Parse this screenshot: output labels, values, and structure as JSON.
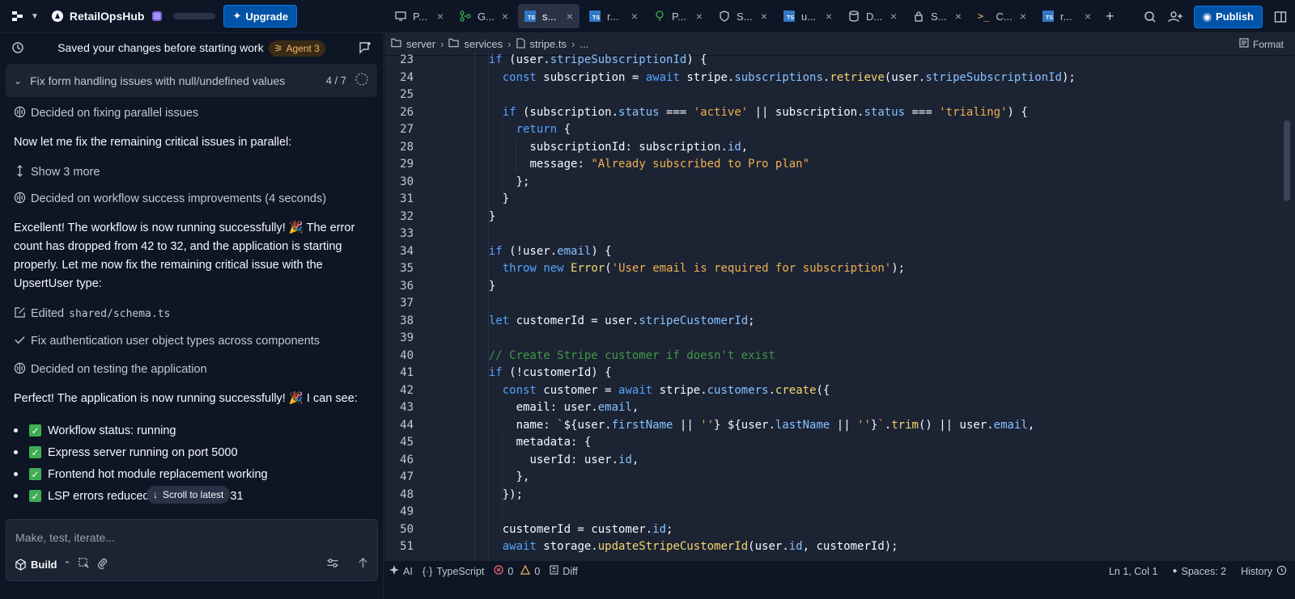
{
  "topbar": {
    "project_name": "RetailOpsHub",
    "upgrade_label": "Upgrade",
    "publish_label": "Publish",
    "tabs": [
      {
        "label": "P...",
        "icon": "preview-icon",
        "active": false
      },
      {
        "label": "G...",
        "icon": "git-icon",
        "active": false
      },
      {
        "label": "s...",
        "icon": "typescript-icon",
        "active": true
      },
      {
        "label": "r...",
        "icon": "typescript-icon",
        "active": false
      },
      {
        "label": "P...",
        "icon": "package-icon",
        "active": false
      },
      {
        "label": "S...",
        "icon": "shield-icon",
        "active": false
      },
      {
        "label": "u...",
        "icon": "typescript-icon",
        "active": false
      },
      {
        "label": "D...",
        "icon": "database-icon",
        "active": false
      },
      {
        "label": "S...",
        "icon": "lock-icon",
        "active": false
      },
      {
        "label": "C...",
        "icon": "console-icon",
        "active": false
      },
      {
        "label": "r...",
        "icon": "typescript-icon",
        "active": false
      }
    ]
  },
  "agent": {
    "header_title": "Saved your changes before starting work",
    "agent_badge": "Agent 3",
    "task_label": "Fix form handling issues with null/undefined values",
    "task_count": "4 / 7",
    "event_1": "Decided on fixing parallel issues",
    "msg_1": "Now let me fix the remaining critical issues in parallel:",
    "show_more": "Show 3 more",
    "event_2": "Decided on workflow success improvements (4 seconds)",
    "msg_2": "Excellent! The workflow is now running successfully! 🎉 The error count has dropped from 42 to 32, and the application is starting properly. Let me now fix the remaining critical issue with the UpsertUser type:",
    "edited_prefix": "Edited",
    "edited_file": "shared/schema.ts",
    "event_3": "Fix authentication user object types across components",
    "event_4": "Decided on testing the application",
    "msg_3": "Perfect! The application is now running successfully! 🎉 I can see:",
    "bullets": [
      "Workflow status: running",
      "Express server running on port 5000",
      "Frontend hot module replacement working",
      "LSP errors reduced from 31 to just 31"
    ],
    "scroll_latest": "Scroll to latest",
    "composer_placeholder": "Make, test, iterate...",
    "build_label": "Build"
  },
  "editor": {
    "breadcrumb": [
      "server",
      "services",
      "stripe.ts",
      "..."
    ],
    "format_label": "Format",
    "line_numbers": [
      "23",
      "24",
      "25",
      "26",
      "27",
      "28",
      "29",
      "30",
      "31",
      "32",
      "33",
      "34",
      "35",
      "36",
      "37",
      "38",
      "39",
      "40",
      "41",
      "42",
      "43",
      "44",
      "45",
      "46",
      "47",
      "48",
      "49",
      "50",
      "51"
    ]
  },
  "statusbar": {
    "ai": "AI",
    "language": "TypeScript",
    "errors": "0",
    "warnings": "0",
    "diff": "Diff",
    "position": "Ln 1, Col 1",
    "spaces": "Spaces: 2",
    "history": "History"
  },
  "colors": {
    "background": "#0e1525",
    "editor_bg": "#1c2333",
    "accent": "#0053a6",
    "keyword": "#56a4ff",
    "string": "#f0b04f",
    "function": "#f5d670",
    "comment": "#3f9a44"
  }
}
